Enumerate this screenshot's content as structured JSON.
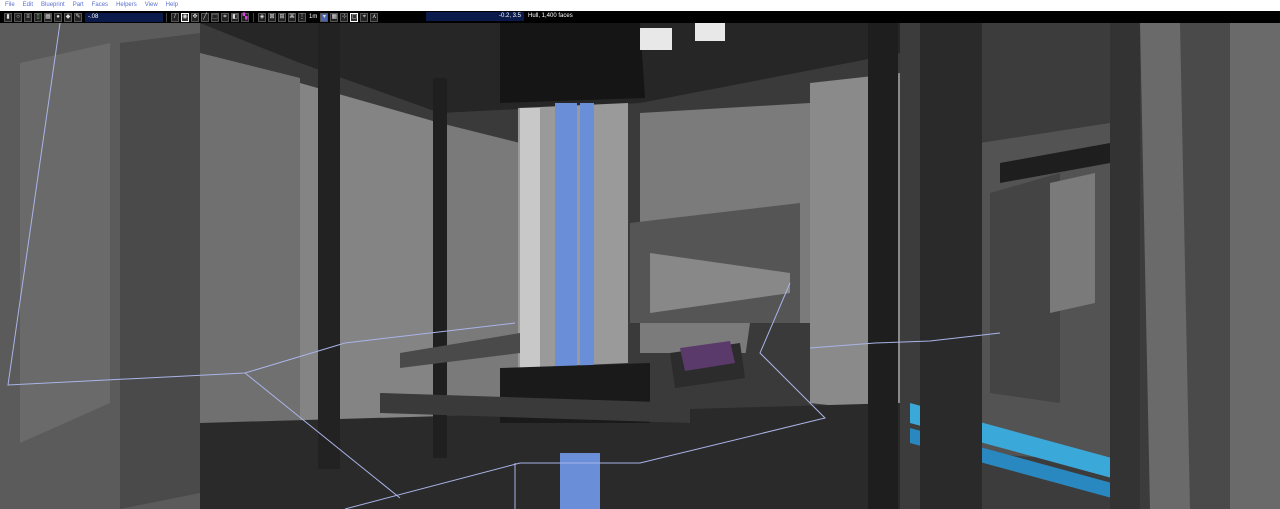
{
  "menu": {
    "items": [
      {
        "label": "File"
      },
      {
        "label": "Edit"
      },
      {
        "label": "Blueprint"
      },
      {
        "label": "Part"
      },
      {
        "label": "Faces"
      },
      {
        "label": "Helpers"
      },
      {
        "label": "View"
      },
      {
        "label": "Help"
      }
    ]
  },
  "toolbar": {
    "value_field": "-.08",
    "grid_label": "1m",
    "coordinates": "-0.2, 3.5",
    "status": "Hull, 1,400 faces"
  },
  "colors": {
    "menu_text": "#5a6fd0",
    "input_bg": "#0a1a4a",
    "accent_blue": "#6a8ed8",
    "wireframe": "#aab4e8"
  }
}
